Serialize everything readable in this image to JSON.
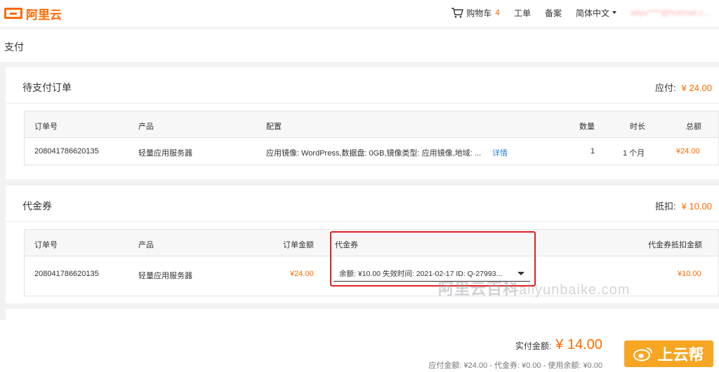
{
  "brand": {
    "logo_text": "阿里云"
  },
  "nav": {
    "cart_label": "购物车",
    "cart_count": "4",
    "tickets": "工单",
    "filing": "备案",
    "language": "简体中文",
    "user_email": "aliyu****@hotmail.c..."
  },
  "page": {
    "title": "支付"
  },
  "pending_orders": {
    "title": "待支付订单",
    "due_label": "应付:",
    "due_amount": "¥ 24.00",
    "columns": {
      "order_no": "订单号",
      "product": "产品",
      "config": "配置",
      "qty": "数量",
      "duration": "时长",
      "total": "总额"
    },
    "row": {
      "order_no": "208041786620135",
      "product": "轻量应用服务器",
      "config": "应用镜像: WordPress,数据盘: 0GB,镜像类型: 应用镜像,地域: ...",
      "details_link": "详情",
      "qty": "1",
      "duration": "1 个月",
      "total": "¥24.00"
    }
  },
  "vouchers": {
    "title": "代金券",
    "deduct_label": "抵扣:",
    "deduct_amount": "¥ 10.00",
    "columns": {
      "order_no": "订单号",
      "product": "产品",
      "order_amount": "订单金额",
      "voucher": "代金券",
      "voucher_deduct": "代金券抵扣金额"
    },
    "row": {
      "order_no": "208041786620135",
      "product": "轻量应用服务器",
      "order_amount": "¥24.00",
      "voucher_selected": "余额: ¥10.00 失效时间: 2021-02-17 ID: Q-27993...",
      "voucher_deduct": "¥10.00"
    }
  },
  "summary": {
    "pay_label": "实付金额:",
    "pay_amount": "¥ 14.00",
    "breakdown": "应付金额: ¥24.00 - 代金券: ¥0.00 - 使用余额: ¥0.00"
  },
  "watermark": {
    "cn": "阿里云百科",
    "en": "aliyunbaike.com"
  },
  "badge": {
    "text": "上云帮"
  },
  "colors": {
    "accent": "#ff6a00",
    "highlight_border": "#e02020",
    "link": "#2f7fd8"
  },
  "icons": {
    "cart": "cart-icon",
    "weibo": "weibo-icon"
  }
}
